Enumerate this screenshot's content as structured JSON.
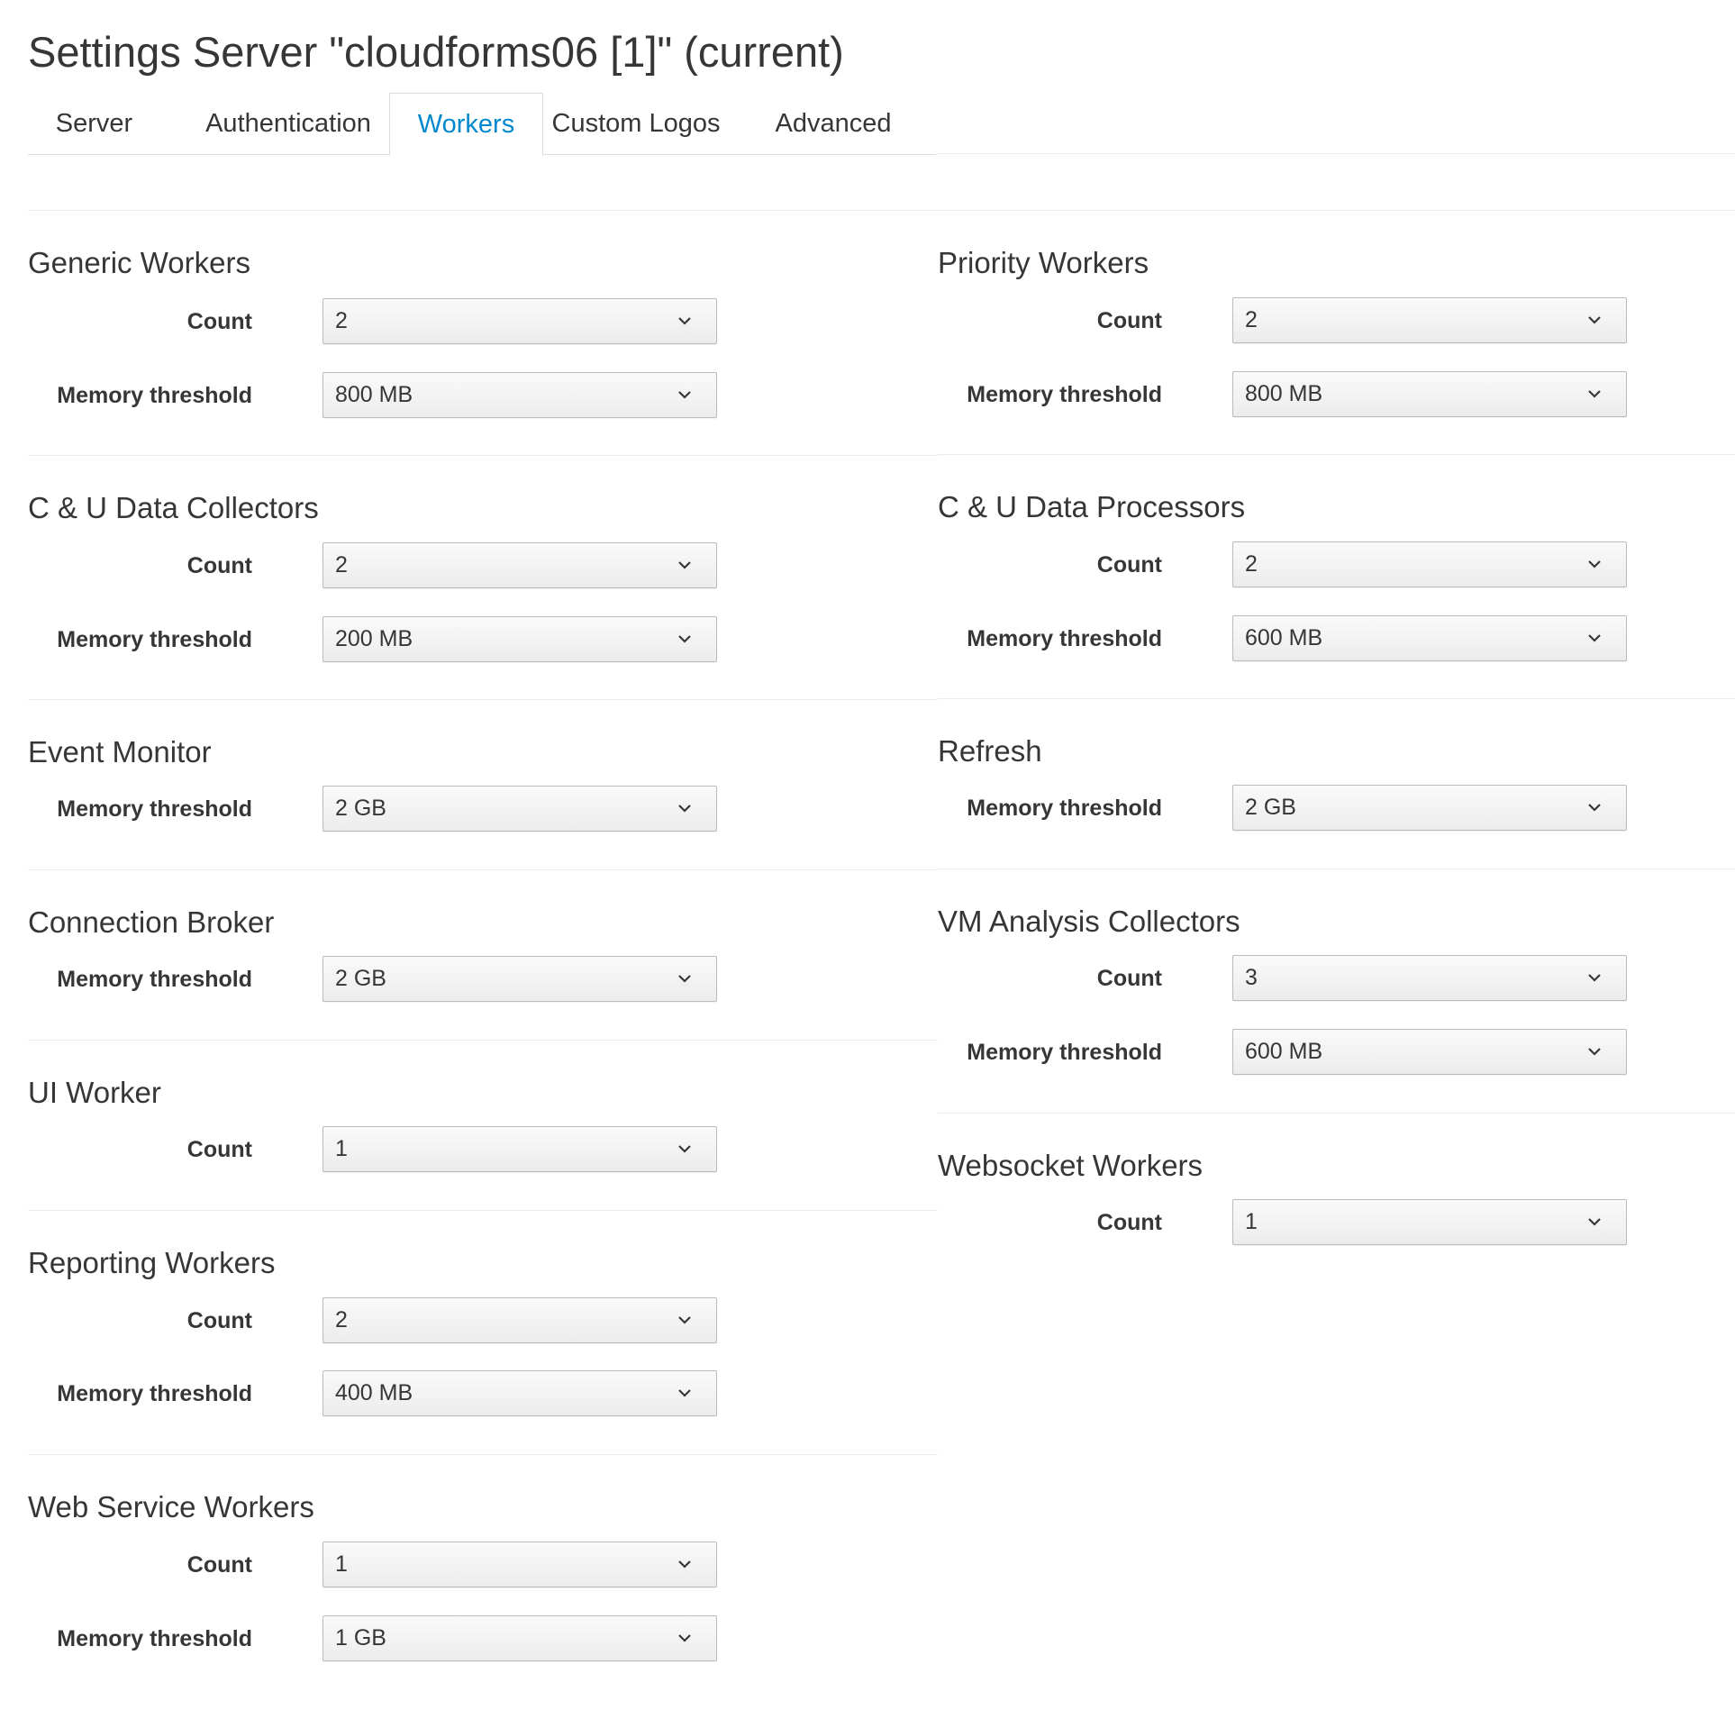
{
  "page": {
    "title": "Settings Server \"cloudforms06 [1]\" (current)"
  },
  "tabs": [
    {
      "label": "Server",
      "active": false
    },
    {
      "label": "Authentication",
      "active": false
    },
    {
      "label": "Workers",
      "active": true
    },
    {
      "label": "Custom Logos",
      "active": false
    },
    {
      "label": "Advanced",
      "active": false
    }
  ],
  "colors": {
    "active_tab": "#0088ce",
    "text": "#363636",
    "select_border": "#bbbbbb"
  },
  "left": [
    {
      "title": "Generic Workers",
      "fields": [
        {
          "label": "Count",
          "value": "2"
        },
        {
          "label": "Memory threshold",
          "value": "800 MB"
        }
      ]
    },
    {
      "title": "C & U Data Collectors",
      "fields": [
        {
          "label": "Count",
          "value": "2"
        },
        {
          "label": "Memory threshold",
          "value": "200 MB"
        }
      ]
    },
    {
      "title": "Event Monitor",
      "fields": [
        {
          "label": "Memory threshold",
          "value": "2 GB"
        }
      ]
    },
    {
      "title": "Connection Broker",
      "fields": [
        {
          "label": "Memory threshold",
          "value": "2 GB"
        }
      ]
    },
    {
      "title": "UI Worker",
      "fields": [
        {
          "label": "Count",
          "value": "1"
        }
      ]
    },
    {
      "title": "Reporting Workers",
      "fields": [
        {
          "label": "Count",
          "value": "2"
        },
        {
          "label": "Memory threshold",
          "value": "400 MB"
        }
      ]
    },
    {
      "title": "Web Service Workers",
      "fields": [
        {
          "label": "Count",
          "value": "1"
        },
        {
          "label": "Memory threshold",
          "value": "1 GB"
        }
      ]
    }
  ],
  "right": [
    {
      "title": "Priority Workers",
      "fields": [
        {
          "label": "Count",
          "value": "2"
        },
        {
          "label": "Memory threshold",
          "value": "800 MB"
        }
      ]
    },
    {
      "title": "C & U Data Processors",
      "fields": [
        {
          "label": "Count",
          "value": "2"
        },
        {
          "label": "Memory threshold",
          "value": "600 MB"
        }
      ]
    },
    {
      "title": "Refresh",
      "fields": [
        {
          "label": "Memory threshold",
          "value": "2 GB"
        }
      ]
    },
    {
      "title": "VM Analysis Collectors",
      "fields": [
        {
          "label": "Count",
          "value": "3"
        },
        {
          "label": "Memory threshold",
          "value": "600 MB"
        }
      ]
    },
    {
      "title": "Websocket Workers",
      "fields": [
        {
          "label": "Count",
          "value": "1"
        }
      ]
    }
  ]
}
